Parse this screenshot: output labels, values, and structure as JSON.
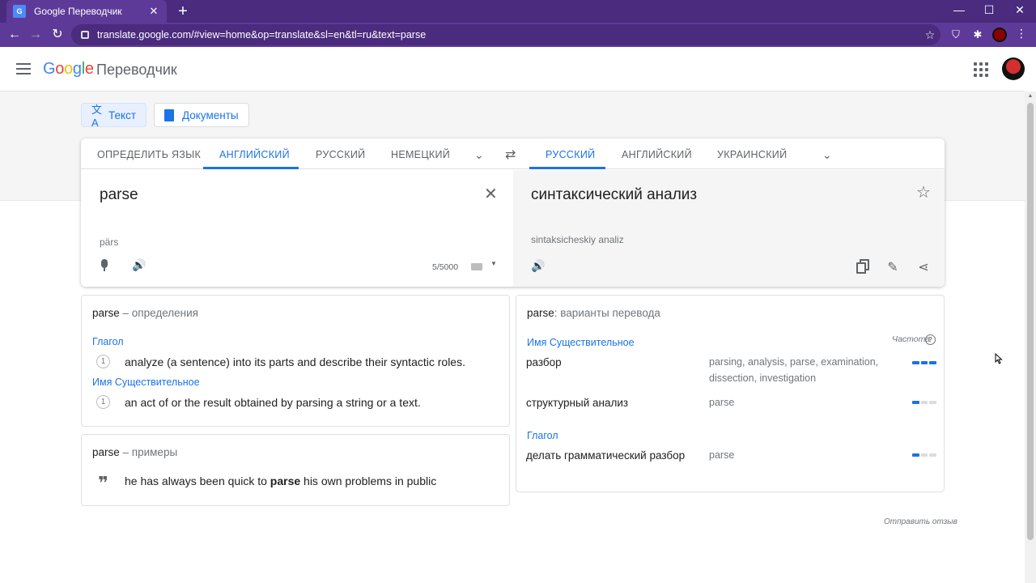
{
  "browser": {
    "tab_title": "Google Переводчик",
    "url": "translate.google.com/#view=home&op=translate&sl=en&tl=ru&text=parse"
  },
  "header": {
    "product_name": "Переводчик"
  },
  "modes": {
    "text_label": "Текст",
    "documents_label": "Документы"
  },
  "source_langs": [
    "ОПРЕДЕЛИТЬ ЯЗЫК",
    "АНГЛИЙСКИЙ",
    "РУССКИЙ",
    "НЕМЕЦКИЙ"
  ],
  "target_langs": [
    "РУССКИЙ",
    "АНГЛИЙСКИЙ",
    "УКРАИНСКИЙ"
  ],
  "source": {
    "text": "parse",
    "transliteration": "pärs",
    "char_count": "5/5000"
  },
  "target": {
    "text": "синтаксический анализ",
    "transliteration": "sintaksicheskiy analiz"
  },
  "definitions": {
    "word": "parse",
    "header_sub": " – определения",
    "groups": [
      {
        "pos": "Глагол",
        "items": [
          {
            "num": "1",
            "text": "analyze (a sentence) into its parts and describe their syntactic roles."
          }
        ]
      },
      {
        "pos": "Имя Существительное",
        "items": [
          {
            "num": "1",
            "text": "an act of or the result obtained by parsing a string or a text."
          }
        ]
      }
    ]
  },
  "examples": {
    "word": "parse",
    "header_sub": " – примеры",
    "before": "he has always been quick to ",
    "bold": "parse",
    "after": " his own problems in public"
  },
  "translations": {
    "word": "parse",
    "header_sub": ": варианты перевода",
    "frequency_label": "Частота",
    "groups": [
      {
        "pos": "Имя Существительное",
        "rows": [
          {
            "word": "разбор",
            "synonyms_line1": "parsing, analysis, parse, examination,",
            "synonyms_line2": "dissection, investigation",
            "frequency": 3
          },
          {
            "word": "структурный анализ",
            "synonyms_line1": "parse",
            "synonyms_line2": "",
            "frequency": 1
          }
        ]
      },
      {
        "pos": "Глагол",
        "rows": [
          {
            "word": "делать грамматический разбор",
            "synonyms_line1": "parse",
            "synonyms_line2": "",
            "frequency": 1
          }
        ]
      }
    ]
  },
  "feedback_label": "Отправить отзыв",
  "colors": {
    "accent": "#1a73e8",
    "chrome": "#5e3a98"
  }
}
